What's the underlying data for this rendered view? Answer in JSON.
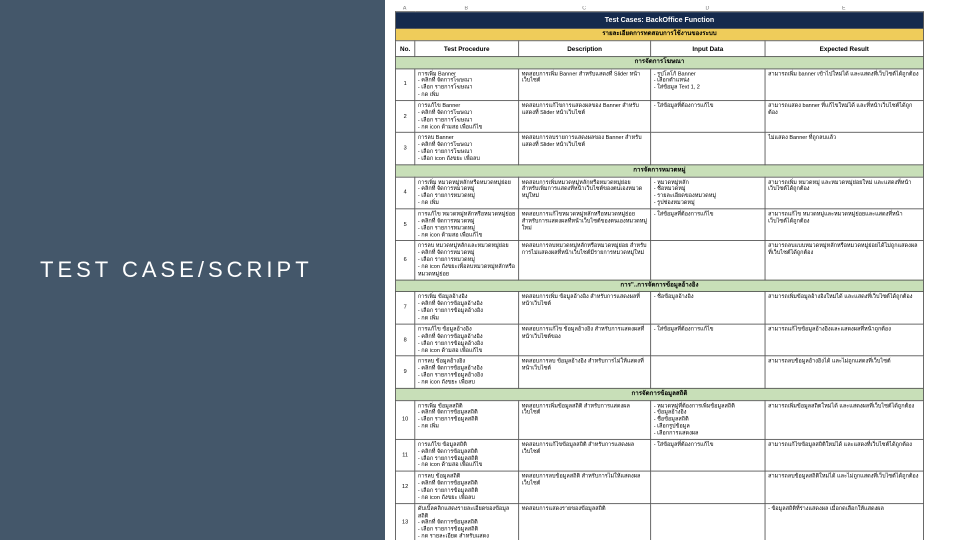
{
  "left": {
    "title": "TEST CASE/SCRIPT"
  },
  "cols": {
    "A": "A",
    "B": "B",
    "C": "C",
    "D": "D",
    "E": "E"
  },
  "header": {
    "title": "Test Cases:  BackOffice Function",
    "subtitle": "รายละเอียดการทดสอบการใช้งานของระบบ",
    "no": "No.",
    "proc": "Test Procedure",
    "desc": "Description",
    "input": "Input Data",
    "expect": "Expected Result"
  },
  "sections": {
    "s1": "การจัดการโฆษณา",
    "s2": "การจัดการหมวดหมู่",
    "s3": "การ\"..การจัดการข้อมูลอ้างอิง",
    "s4": "การจัดการข้อมูลสถิติ"
  },
  "rows": {
    "r1": {
      "no": "1",
      "proc": "การเพิ่ม Banner\n- คลิกที่ จัดการโฆษณา\n- เลือก รายการโฆษณา\n- กด เพิ่ม",
      "desc": "ทดสอบการเพิ่ม Banner สำหรับแสดงที่ Slider หน้าเว็บไซต์",
      "input": "- รูปโลโก้ Banner\n- เลือกตำแหน่ง\n- ใส่ข้อมูล Text 1, 2",
      "expect": "สามารถเพิ่ม banner เข้าไปใหม่ได้ และแสดงที่เว็บไซต์ได้ถูกต้อง"
    },
    "r2": {
      "no": "2",
      "proc": "การแก้ไข Banner\n- คลิกที่ จัดการโฆษณา\n- เลือก รายการโฆษณา\n- กด icon ด้ามสอ เพื่อแก้ไข",
      "desc": "ทดสอบการแก้ไขการแสดงผลของ Banner สำหรับแสดงที่ Slider หน้าเว็บไซต์",
      "input": "- ใส่ข้อมูลที่ต้องการแก้ไข",
      "expect": "สามารถแสดง banner ที่แก้ไขใหม่ได้ และที่หน้าเว็บไซต์ได้ถูกต้อง"
    },
    "r3": {
      "no": "3",
      "proc": "การลบ Banner\n- คลิกที่ จัดการโฆษณา\n- เลือก รายการโฆษณา\n- เลือก icon ถังขยะ เพื่อลบ",
      "desc": "ทดสอบการลบรายการแสดงผลของ Banner สำหรับแสดงที่ Slider หน้าเว็บไซต์",
      "input": "",
      "expect": "ไม่แสดง Banner ที่ถูกลบแล้ว"
    },
    "r4": {
      "no": "4",
      "proc": "การเพิ่ม หมวดหมู่หลักหรือหมวดหมู่ย่อย\n- คลิกที่ จัดการหมวดหมู่\n- เลือก รายการหมวดหมู่\n- กด เพิ่ม",
      "desc": "ทดสอบการเพิ่มหมวดหมู่หลักหรือหมวดหมู่ย่อย สำหรับเพิ่มการแสดงที่หน้าเว็บไซต์ของตนเองหมวดหมู่ใหม่",
      "input": "- หมวดหมู่หลัก\n- ชื่อหมวดหมู่\n- รายละเอียดของหมวดหมู่\n- รูปช่องหมวดหมู่",
      "expect": "สามารถเพิ่ม หมวดหมู่ และหมวดหมู่ย่อยใหม่ และแสดงที่หน้าเว็บไซต์ได้ถูกต้อง"
    },
    "r5": {
      "no": "5",
      "proc": "การแก้ไข หมวดหมู่หลักหรือหมวดหมู่ย่อย\n- คลิกที่ จัดการหมวดหมู่\n- เลือก รายการหมวดหมู่\n- กด icon ด้ามสอ เพื่อแก้ไข",
      "desc": "ทดสอบการแก้ไขหมวดหมู่หลักหรือหมวดหมู่ย่อย สำหรับการแสดงผลที่หน้าเว็บไซต์ของตนเองหมวดหมู่ใหม่",
      "input": "- ใส่ข้อมูลที่ต้องการแก้ไข",
      "expect": "สามารถแก้ไข หมวดหมู่และหมวดหมู่ย่อยและแสดงที่หน้าเว็บไซต์ได้ถูกต้อง"
    },
    "r6": {
      "no": "6",
      "proc": "การลบ หมวดหมู่หลักและหมวดหมู่ย่อย\n- คลิกที่ จัดการหมวดหมู่\n- เลือก รายการหมวดหมู่\n- กด icon ถังขยะเพื่อลบหมวดหมู่หลักหรือหมวดหมู่ย่อย",
      "desc": "ทดสอบการลบหมวดหมู่หลักหรือหมวดหมู่ย่อย สำหรับการไม่แสดงผลที่หน้าเว็บไซต์มีรายการหมวดหมู่ใหม่",
      "input": "",
      "expect": "สามารถลบแบบหมวดหมู่หลักหรือหมวดหมู่ย่อยได้ไม่ถูกแสดงผลที่เว็บไซต์ได้ถูกต้อง"
    },
    "r7": {
      "no": "7",
      "proc": "การเพิ่ม ข้อมูลอ้างอิง\n- คลิกที่ จัดการข้อมูลอ้างอิง\n- เลือก รายการข้อมูลอ้างอิง\n- กด เพิ่ม",
      "desc": "ทดสอบการเพิ่ม ข้อมูลอ้างอิง สำหรับการแสดงผลที่หน้าเว็บไซต์",
      "input": "- ชื่อข้อมูลอ้างอิง",
      "expect": "สามารถเพิ่มข้อมูลอ้างอิงใหม่ได้ และแสดงที่เว็บไซต์ได้ถูกต้อง"
    },
    "r8": {
      "no": "8",
      "proc": "การแก้ไข ข้อมูลอ้างอิง\n- คลิกที่ จัดการข้อมูลอ้างอิง\n- เลือก รายการข้อมูลอ้างอิง\n- กด icon ด้ามสอ เพื่อแก้ไข",
      "desc": "ทดสอบการแก้ไข ข้อมูลอ้างอิง สำหรับการแสดงผลที่หน้าเว็บไซต์ของ",
      "input": "- ใส่ข้อมูลที่ต้องการแก้ไข",
      "expect": "สามารถแก้ไขข้อมูลอ้างอิงและแสดงผลที่หน้าถูกต้อง"
    },
    "r9": {
      "no": "9",
      "proc": "การลบ ข้อมูลอ้างอิง\n- คลิกที่ จัดการข้อมูลอ้างอิง\n- เลือก รายการข้อมูลอ้างอิง\n- กด icon ถังขยะ เพื่อลบ",
      "desc": "ทดสอบการลบ ข้อมูลอ้างอิง สำหรับการไม่ให้แสดงที่หน้าเว็บไซต์",
      "input": "",
      "expect": "สามารถลบข้อมูลอ้างอิงได้ และไม่ถูกแสดงที่เว็บไซต์"
    },
    "r10": {
      "no": "10",
      "proc": "การเพิ่ม ข้อมูลสถิติ\n- คลิกที่ จัดการข้อมูลสถิติ\n- เลือก รายการข้อมูลสถิติ\n- กด เพิ่ม",
      "desc": "ทดสอบการเพิ่มข้อมูลสถิติ สำหรับการแสดงผลเว็บไซต์",
      "input": "- หมวดหมู่ที่ต้องการเพิ่มข้อมูลสถิติ\n- ข้อมูลอ้างอิง\n- ชื่อข้อมูลสถิติ\n- เลือกรูปข้อมูล\n- เลือกการแสดงผล",
      "expect": "สามารถเพิ่มข้อมูลสถิตใหม่ได้ และแสดงผลที่เว็บไซต์ได้ถูกต้อง"
    },
    "r11": {
      "no": "11",
      "proc": "การแก้ไข ข้อมูลสถิติ\n- คลิกที่ จัดการข้อมูลสถิติ\n- เลือก รายการข้อมูลสถิติ\n- กด icon ด้ามสอ เพื่อแก้ไข",
      "desc": "ทดสอบการแก้ไขข้อมูลสถิติ สำหรับการแสดงผลเว็บไซต์",
      "input": "- ใส่ข้อมูลที่ต้องการแก้ไข",
      "expect": "สามารถแก้ไขข้อมูลสถิติใหม่ได้ และแสดงที่เว็บไซต์ได้ถูกต้อง"
    },
    "r12": {
      "no": "12",
      "proc": "การลบ ข้อมูลสถิติ\n- คลิกที่ จัดการข้อมูลสถิติ\n- เลือก รายการข้อมูลสถิติ\n- กด icon ถังขยะ เพื่อลบ",
      "desc": "ทดสอบการลบข้อมูลสถิติ สำหรับการไม่ให้แสดงผลเว็บไซต์",
      "input": "",
      "expect": "สามารถลบข้อมูลสถิติใหม่ได้ และไม่ถูกแสดงที่เว็บไซต์ได้ถูกต้อง"
    },
    "r13": {
      "no": "13",
      "proc": "ดับเบิ้ลคลิกแสดงรายละเอียดของข้อมูลสถิติ\n- คลิกที่ จัดการข้อมูลสถิติ\n- เลือก รายการข้อมูลสถิติ\n- กด รายละเอียด สำหรับแสดง",
      "desc": "ทดสอบการแสดงรายของข้อมูลสถิติ",
      "input": "",
      "expect": "- ข้อมูลสถิติที่ร่างแสดงผล เมื่อกดเลือกให้แสดงผล"
    }
  }
}
